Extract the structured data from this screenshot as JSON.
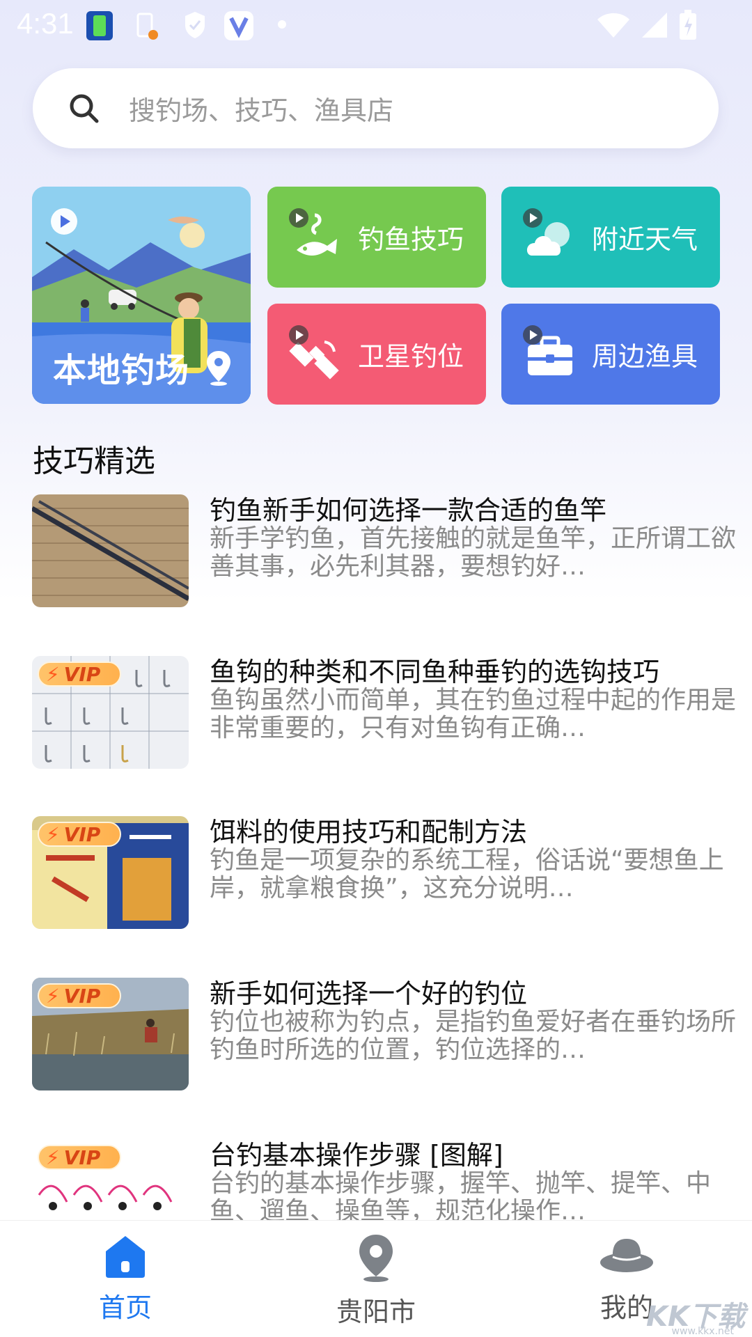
{
  "status_bar": {
    "time": "4:31"
  },
  "search": {
    "placeholder": "搜钓场、技巧、渔具店"
  },
  "tiles": {
    "local": {
      "label": "本地钓场"
    },
    "skills": {
      "label": "钓鱼技巧"
    },
    "weather": {
      "label": "附近天气"
    },
    "satellite": {
      "label": "卫星钓位"
    },
    "gear": {
      "label": "周边渔具"
    }
  },
  "section": {
    "title": "技巧精选"
  },
  "articles": [
    {
      "title": "钓鱼新手如何选择一款合适的鱼竿",
      "desc": "新手学钓鱼，首先接触的就是鱼竿，正所谓工欲善其事，必先利其器，要想钓好…",
      "vip": ""
    },
    {
      "title": "鱼钩的种类和不同鱼种垂钓的选钩技巧",
      "desc": "鱼钩虽然小而简单，其在钓鱼过程中起的作用是非常重要的，只有对鱼钩有正确…",
      "vip": "VIP"
    },
    {
      "title": "饵料的使用技巧和配制方法",
      "desc": "钓鱼是一项复杂的系统工程，俗话说“要想鱼上岸，就拿粮食换”，这充分说明…",
      "vip": "VIP"
    },
    {
      "title": "新手如何选择一个好的钓位",
      "desc": "钓位也被称为钓点，是指钓鱼爱好者在垂钓场所钓鱼时所选的位置，钓位选择的…",
      "vip": "VIP"
    },
    {
      "title": "台钓基本操作步骤 [图解]",
      "desc": "台钓的基本操作步骤，握竿、抛竿、提竿、中鱼、遛鱼、操鱼等，规范化操作…",
      "vip": "VIP"
    }
  ],
  "bottom_nav": {
    "home": "首页",
    "city": "贵阳市",
    "me": "我的"
  },
  "watermark": {
    "text": "KK下载",
    "sub": "www.kkx.net"
  },
  "colors": {
    "accent": "#1e78f0",
    "green_tile": "#76c94f",
    "teal_tile": "#1fbfb8",
    "red_tile": "#f45b74",
    "blue_tile": "#4f78e8"
  }
}
